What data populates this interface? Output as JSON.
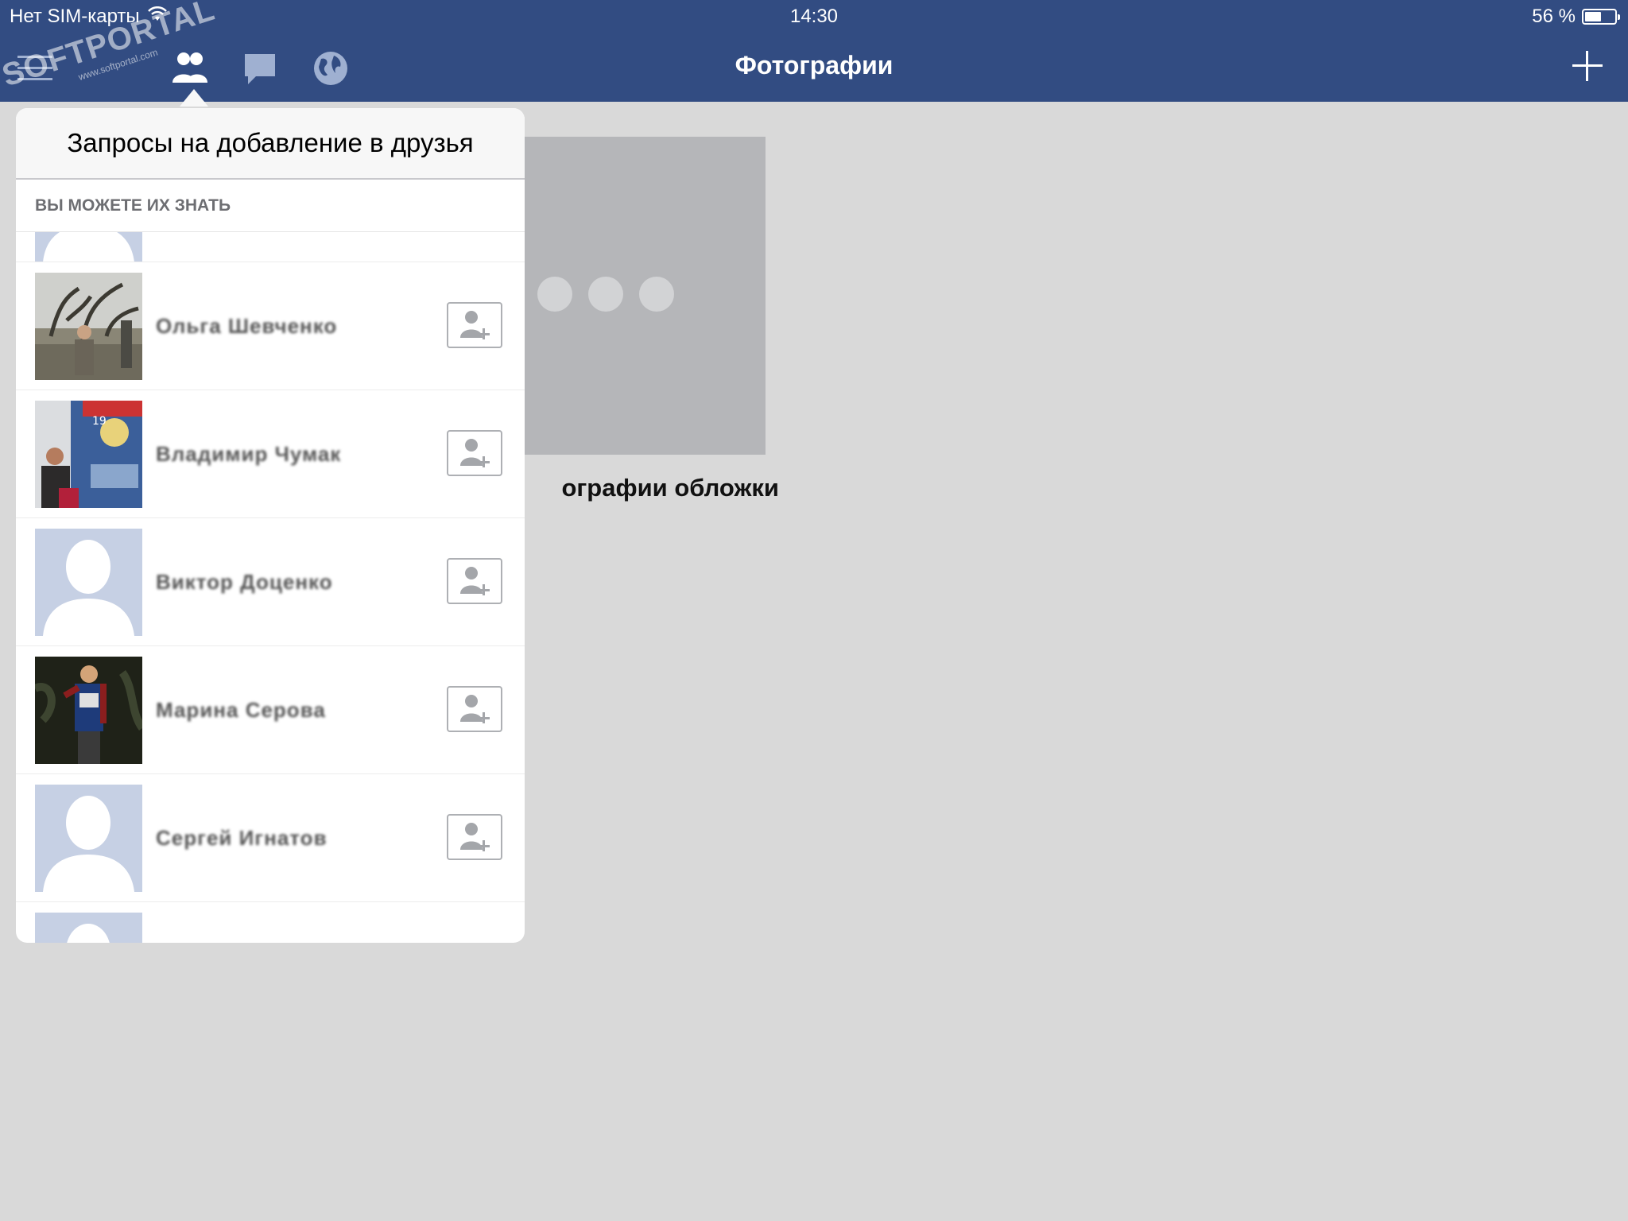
{
  "status_bar": {
    "carrier": "Нет SIM-карты",
    "time": "14:30",
    "battery": "56 %",
    "battery_level": 0.56
  },
  "nav": {
    "title": "Фотографии",
    "icons": [
      "menu-icon",
      "friends-icon",
      "messages-icon",
      "globe-icon",
      "add-icon"
    ]
  },
  "watermark": {
    "text": "SOFTPORTAL",
    "sub": "www.softportal.com"
  },
  "album": {
    "label": "ографии обложки"
  },
  "popover": {
    "title": "Запросы на добавление в друзья",
    "section_header": "ВЫ МОЖЕТЕ ИХ ЗНАТЬ",
    "people": [
      {
        "name": "Ольга Шевченко",
        "avatar": "photo-tree"
      },
      {
        "name": "Владимир Чумак",
        "avatar": "photo-poster"
      },
      {
        "name": "Виктор Доценко",
        "avatar": "placeholder"
      },
      {
        "name": "Марина Серова",
        "avatar": "photo-night"
      },
      {
        "name": "Сергей Игнатов",
        "avatar": "placeholder"
      }
    ]
  },
  "colors": {
    "navbar": "#324c82",
    "background": "#d9d9d9",
    "placeholder_avatar": "#c6d0e4"
  }
}
